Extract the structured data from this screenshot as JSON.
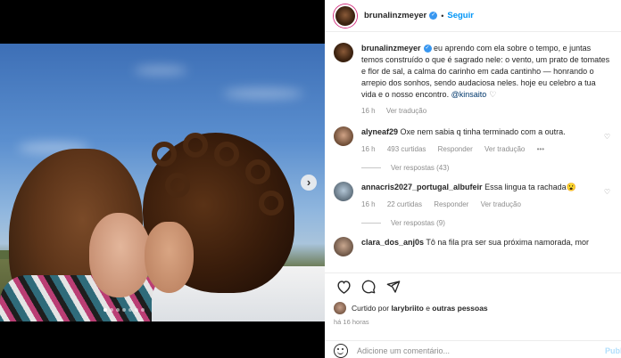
{
  "post": {
    "author": "bruna­linzmeyer",
    "follow_label": "Seguir",
    "separator": "•"
  },
  "caption": {
    "author": "brunalinzmeyer",
    "text": "eu aprendo com ela sobre o tempo, e juntas temos construído o que é sagrado nele: o vento, um prato de tomates e flor de sal, a calma do carinho em cada cantinho — honrando o arrepio dos sonhos, sendo audaciosa neles. hoje eu celebro a tua vida e o nosso encontro. ",
    "mention": "@kinsaito",
    "time": "16 h",
    "translate": "Ver tradução"
  },
  "comments": [
    {
      "user": "alyneaf29",
      "text": "Oxe nem sabia q tinha terminado com a outra.",
      "time": "16 h",
      "likes": "493 curtidas",
      "reply": "Responder",
      "translate": "Ver tradução",
      "more": "•••",
      "replies": "Ver respostas (43)"
    },
    {
      "user": "annacris2027_portugal_albufeir",
      "text": "Essa lingua ta rachada😮",
      "time": "16 h",
      "likes": "22 curtidas",
      "reply": "Responder",
      "translate": "Ver tradução",
      "replies": "Ver respostas (9)"
    },
    {
      "user": "clara_dos_anj0s",
      "text": "Tô na fila pra ser sua próxima namorada, mor"
    }
  ],
  "likes": {
    "prefix": "Curtido por ",
    "user": "larybriito",
    "suffix": " e ",
    "others": "outras pessoas"
  },
  "timestamp": "há 16 horas",
  "comment_box": {
    "placeholder": "Adicione um comentário...",
    "publish": "Publi"
  },
  "carousel": {
    "total": 7,
    "active": 0
  },
  "icons": [
    "heart-icon",
    "comment-icon",
    "share-icon",
    "emoji-icon",
    "verified-icon",
    "chevron-right-icon"
  ]
}
